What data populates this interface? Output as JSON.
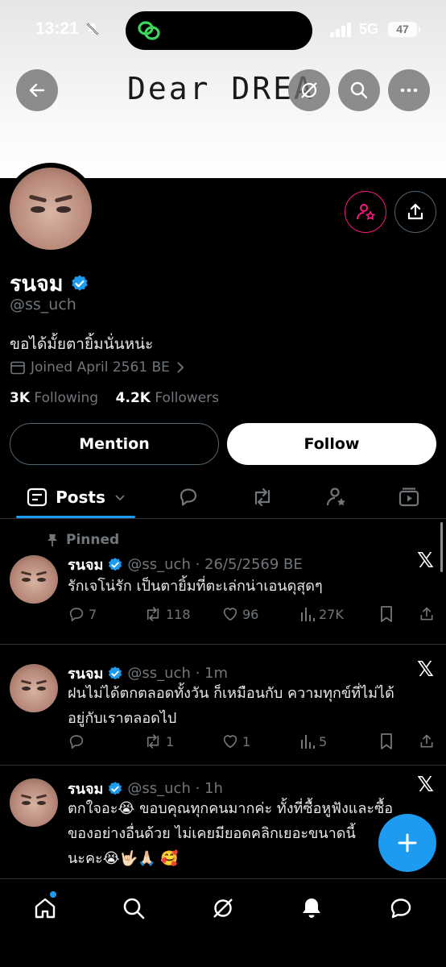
{
  "status": {
    "time": "13:21",
    "network": "5G",
    "battery": "47"
  },
  "banner": {
    "text": "Dear DREA"
  },
  "profile": {
    "name": "รนจม",
    "handle": "@ss_uch",
    "bio": "ขอได้มั้ยตายิ้มนั่นหน่ะ",
    "joined": "Joined April 2561 BE",
    "following_count": "3K",
    "following_label": "Following",
    "followers_count": "4.2K",
    "followers_label": "Followers"
  },
  "buttons": {
    "mention": "Mention",
    "follow": "Follow"
  },
  "tabs": {
    "posts": "Posts"
  },
  "pinned_label": "Pinned",
  "posts": [
    {
      "name": "รนจม",
      "meta": "@ss_uch · 26/5/2569 BE",
      "lines": [
        "รักเจโน่รัก เป็นตายิ้มที่ตะเล่กน่าเอนดุสุดๆ"
      ],
      "replies": "7",
      "reposts": "118",
      "likes": "96",
      "views": "27K"
    },
    {
      "name": "รนจม",
      "meta": "@ss_uch · 1m",
      "lines": [
        "ฝนไม่ได้ตกตลอดทั้งวัน ก็เหมือนกับ ความทุกข์ที่ไม่ได้",
        "อยู่กับเราตลอดไป"
      ],
      "replies": "",
      "reposts": "1",
      "likes": "1",
      "views": "5"
    },
    {
      "name": "รนจม",
      "meta": "@ss_uch · 1h",
      "lines": [
        "ตกใจอะ😭 ขอบคุณทุกคนมากค่ะ ทั้งที่ซื้อหูฟังและซื้อ",
        "ของอย่างอื่นด้วย ไม่เคยมียอดคลิกเยอะขนาดนี้",
        "นะคะ😭🤟🏻🙏🏻 🥰"
      ]
    }
  ],
  "x_logo": "𝕏"
}
